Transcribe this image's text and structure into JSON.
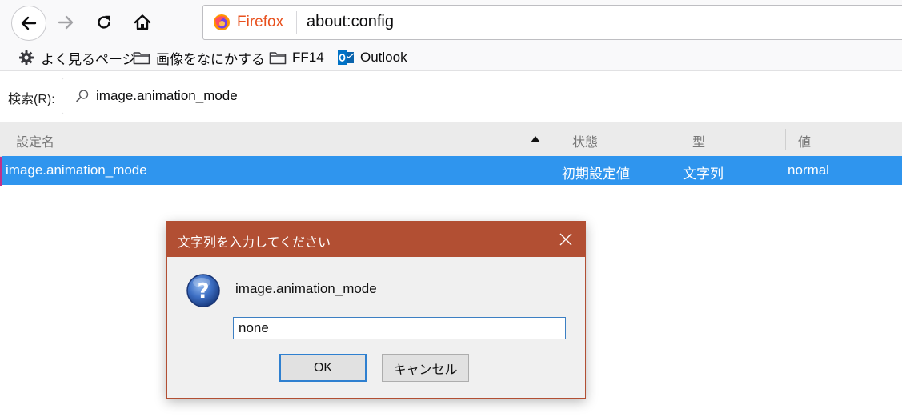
{
  "browser": {
    "brand": "Firefox",
    "url": "about:config"
  },
  "bookmarks": [
    {
      "label": "よく見るページ",
      "icon": "gear-icon"
    },
    {
      "label": "画像をなにかする",
      "icon": "folder-icon"
    },
    {
      "label": "FF14",
      "icon": "folder-icon"
    },
    {
      "label": "Outlook",
      "icon": "outlook-icon"
    }
  ],
  "search": {
    "label": "検索(R):",
    "value": "image.animation_mode"
  },
  "table": {
    "headers": [
      "設定名",
      "状態",
      "型",
      "値"
    ],
    "rows": [
      {
        "name": "image.animation_mode",
        "status": "初期設定値",
        "type": "文字列",
        "value": "normal"
      }
    ]
  },
  "dialog": {
    "title": "文字列を入力してください",
    "message": "image.animation_mode",
    "input_value": "none",
    "ok_label": "OK",
    "cancel_label": "キャンセル"
  },
  "colors": {
    "selection": "#2f95ee",
    "dialog_title": "#b24f33",
    "firefox_brand": "#e8501d"
  }
}
